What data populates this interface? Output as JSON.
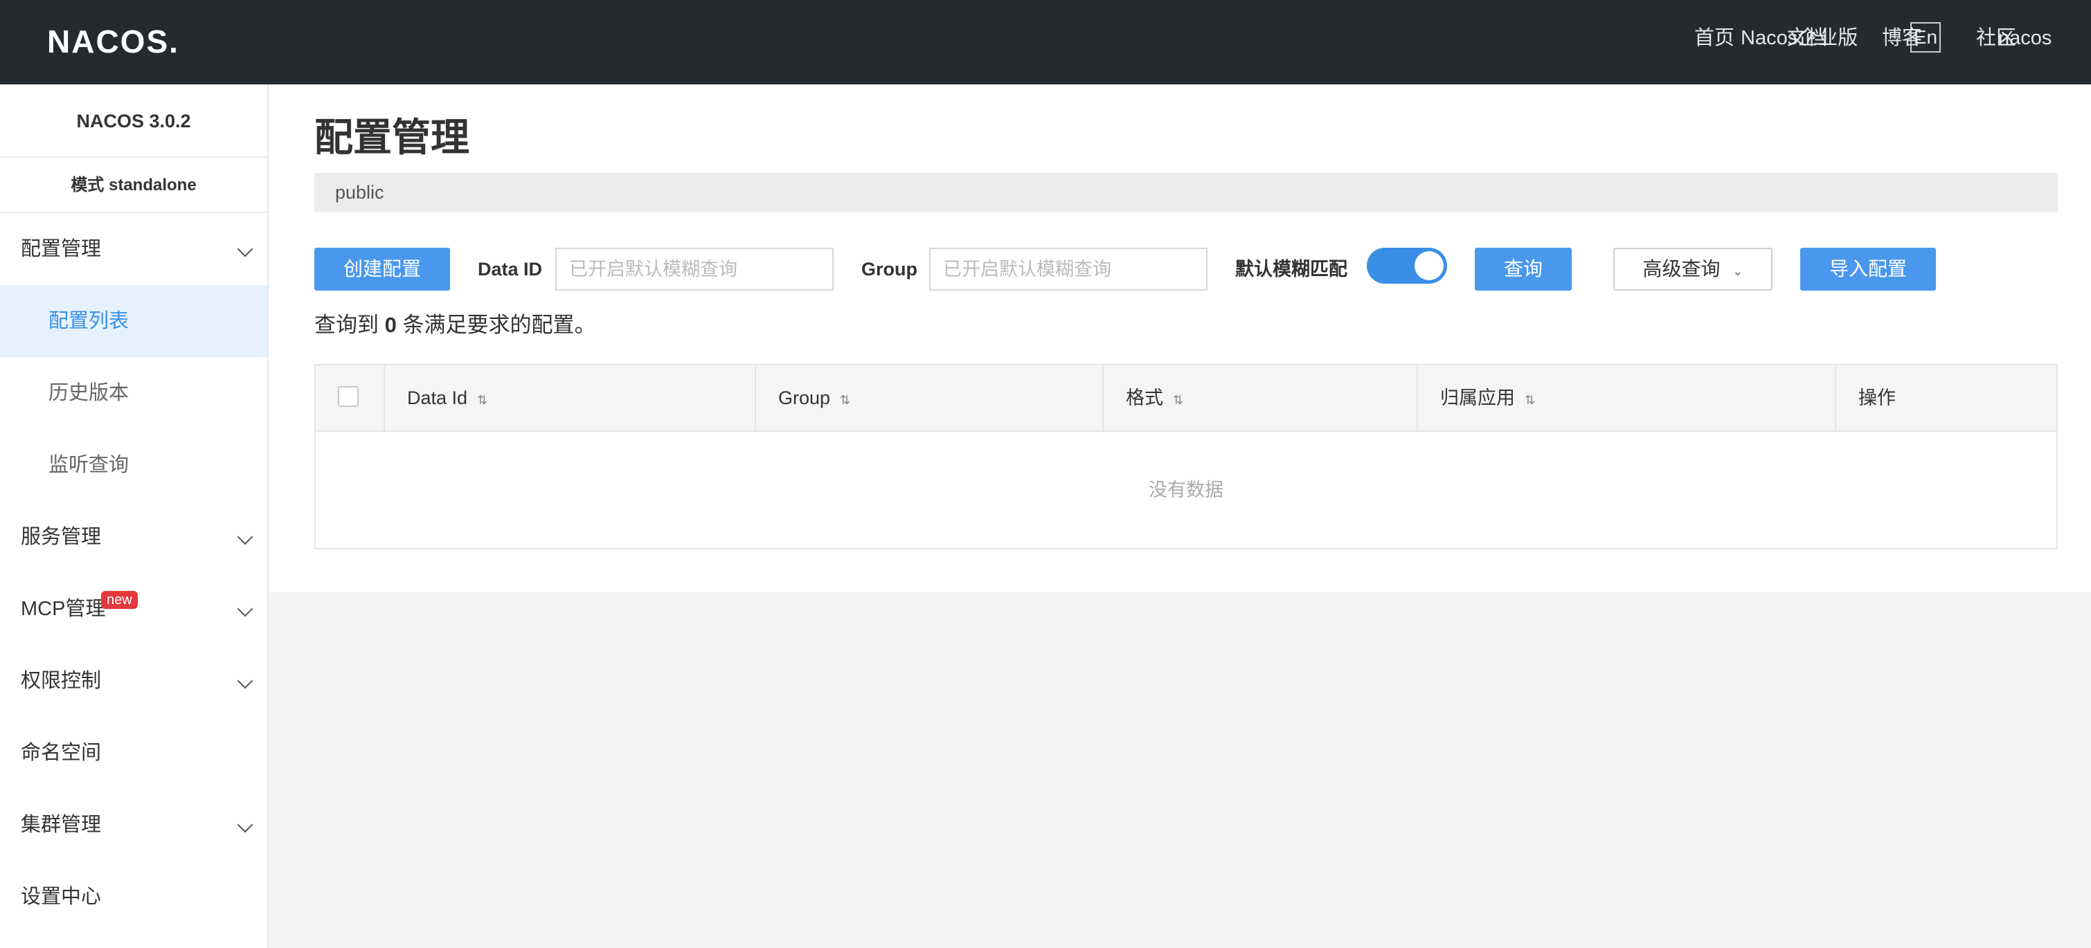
{
  "header": {
    "logo_text": "NACOS.",
    "nav": [
      "首页",
      "文档",
      "博客",
      "社区",
      "Nacos企业版"
    ],
    "lang": "En",
    "user": "nacos"
  },
  "sidebar": {
    "version": "NACOS 3.0.2",
    "mode": "模式 standalone",
    "items": [
      {
        "label": "配置管理",
        "expandable": true
      },
      {
        "label": "配置列表",
        "sub": true,
        "active": true
      },
      {
        "label": "历史版本",
        "sub": true
      },
      {
        "label": "监听查询",
        "sub": true
      },
      {
        "label": "服务管理",
        "expandable": true
      },
      {
        "label": "MCP管理",
        "expandable": true,
        "badge": "new"
      },
      {
        "label": "权限控制",
        "expandable": true
      },
      {
        "label": "命名空间"
      },
      {
        "label": "集群管理",
        "expandable": true
      },
      {
        "label": "设置中心"
      }
    ]
  },
  "main": {
    "title": "配置管理",
    "namespace": "public",
    "create_button": "创建配置",
    "dataid_label": "Data ID",
    "dataid_placeholder": "已开启默认模糊查询",
    "group_label": "Group",
    "group_placeholder": "已开启默认模糊查询",
    "fuzzy_label": "默认模糊匹配",
    "fuzzy_on": true,
    "query_button": "查询",
    "advanced_button": "高级查询",
    "import_button": "导入配置",
    "result_prefix": "查询到",
    "result_count": "0",
    "result_suffix": "条满足要求的配置。",
    "table": {
      "columns": [
        "Data Id",
        "Group",
        "格式",
        "归属应用",
        "操作"
      ],
      "empty_text": "没有数据"
    }
  },
  "colors": {
    "topbar": "#252a2f",
    "primary": "#4a98ed",
    "active_bg": "#e5f2fd",
    "badge": "#e4393c"
  }
}
